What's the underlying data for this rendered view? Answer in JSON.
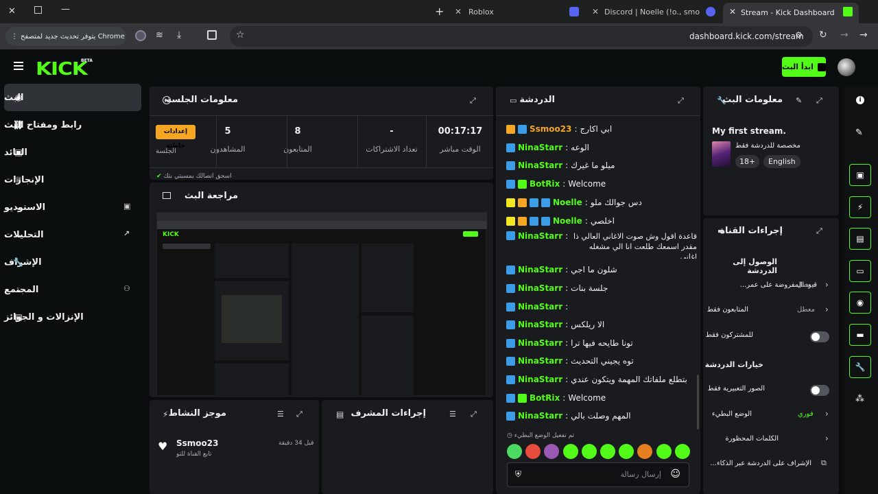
{
  "browser": {
    "tabs": [
      {
        "title": "Roblox"
      },
      {
        "title": "Discord | Noelle (!o., smo"
      },
      {
        "title": "Stream - Kick Dashboard"
      }
    ],
    "update_notice": "يتوفر تحديث جديد لمتصفح Chrome",
    "url": "dashboard.kick.com/stream"
  },
  "header": {
    "logo": "KICK",
    "logo_badge": "BETA",
    "go_live_label": "ابدأ البث"
  },
  "sidebar": {
    "items": [
      {
        "label": "البث"
      },
      {
        "label": "رابط ومفتاح البث"
      },
      {
        "label": "العائد"
      },
      {
        "label": "الإنجازات"
      },
      {
        "label": "الاستوديو"
      },
      {
        "label": "التحليلات"
      },
      {
        "label": "الإشراف"
      },
      {
        "label": "المجتمع"
      },
      {
        "label": "الإنزالات و الجوائز"
      }
    ]
  },
  "session": {
    "title": "معلومات الجلسة",
    "stats": [
      {
        "value": "00:17:17",
        "label": "الوقت مباشر"
      },
      {
        "value": "-",
        "label": "تعداد الاشتراكات"
      },
      {
        "value": "8",
        "label": "المتابعون"
      },
      {
        "value": "5",
        "label": "المشاهدون"
      }
    ],
    "settings_button": "إعدادات خاطئة",
    "settings_label": "الجلسة",
    "partial_text": "اسحق اتصالك بمسبتي بثك"
  },
  "preview": {
    "title": "مراجعة البث"
  },
  "activity": {
    "title": "موجز النشاط",
    "item_user": "Ssmoo23",
    "item_text": "تابع القناة للتو",
    "item_time": "قبل 34 دقيقة"
  },
  "mod_actions": {
    "title": "إجراءات المشرف"
  },
  "chat": {
    "title": "الدردشة",
    "messages": [
      {
        "user": "Ssmoo23",
        "color": "#f5a623",
        "text": "ابي اكارج",
        "badges": [
          "crown",
          "pin"
        ]
      },
      {
        "user": "NinaStarr",
        "color": "#53fc18",
        "text": "الوعه",
        "badges": [
          "pin"
        ]
      },
      {
        "user": "NinaStarr",
        "color": "#53fc18",
        "text": "ميلو ما غيرك",
        "badges": [
          "pin"
        ]
      },
      {
        "user": "BotRix",
        "color": "#53fc18",
        "text": "Welcome",
        "badges": [
          "pin",
          "verified"
        ]
      },
      {
        "user": "Noelle",
        "color": "#53fc18",
        "text": "دس جوالك ملو",
        "badges": [
          "sub",
          "crown",
          "pin",
          "gift"
        ]
      },
      {
        "user": "Noelle",
        "color": "#53fc18",
        "text": "اخلصي",
        "badges": [
          "sub",
          "crown",
          "pin",
          "gift"
        ]
      },
      {
        "user": "NinaStarr",
        "color": "#53fc18",
        "text": "قاعدة اقول وش صوت الاغاني العالي ذا مقدر اسمعك طلعت انا الي مشغله اغاني",
        "badges": [
          "pin"
        ]
      },
      {
        "user": "NinaStarr",
        "color": "#53fc18",
        "text": "شلون ما اجي",
        "badges": [
          "pin"
        ]
      },
      {
        "user": "NinaStarr",
        "color": "#53fc18",
        "text": "جلسة بنات",
        "badges": [
          "pin"
        ]
      },
      {
        "user": "NinaStarr",
        "color": "#53fc18",
        "text": "",
        "badges": [
          "pin"
        ]
      },
      {
        "user": "NinaStarr",
        "color": "#53fc18",
        "text": "الا ريلكس",
        "badges": [
          "pin"
        ]
      },
      {
        "user": "NinaStarr",
        "color": "#53fc18",
        "text": "تونا طايحه فيها ترا",
        "badges": [
          "pin"
        ]
      },
      {
        "user": "NinaStarr",
        "color": "#53fc18",
        "text": "توه يجيني التحديث",
        "badges": [
          "pin"
        ]
      },
      {
        "user": "NinaStarr",
        "color": "#53fc18",
        "text": "بتطلع ملفاتك المهمة ويتكون عندي",
        "badges": [
          "pin"
        ]
      },
      {
        "user": "BotRix",
        "color": "#53fc18",
        "text": "Welcome",
        "badges": [
          "pin",
          "verified"
        ]
      },
      {
        "user": "NinaStarr",
        "color": "#53fc18",
        "text": "المهم وصلت بالي",
        "badges": [
          "pin"
        ]
      }
    ],
    "slow_mode_notice": "تم تفعيل الوضع البطيء",
    "input_placeholder": "إرسال رسالة"
  },
  "stream_info": {
    "title": "معلومات البث",
    "stream_title": "My first stream.",
    "category": "مخصصة للدردشة فقط",
    "tags": [
      "18+",
      "English"
    ]
  },
  "channel_actions": {
    "title": "إجراءات القناة",
    "access_heading": "الوصول إلى الدردشة",
    "access_rows": [
      {
        "label": "قيود المفروضة على عمر...",
        "value": "معطل"
      },
      {
        "label": "المتابعون فقط",
        "value": "معطل"
      },
      {
        "label": "للمشتركون فقط",
        "value": ""
      }
    ],
    "options_heading": "خيارات الدردشة",
    "option_rows": [
      {
        "label": "الصور التعبيرية فقط",
        "value": ""
      },
      {
        "label": "الوضع البطيء",
        "value": "فوري"
      },
      {
        "label": "الكلمات المحظورة",
        "value": ""
      },
      {
        "label": "الإشراف على الدردشة عبر الذكاء...",
        "value": ""
      }
    ]
  }
}
